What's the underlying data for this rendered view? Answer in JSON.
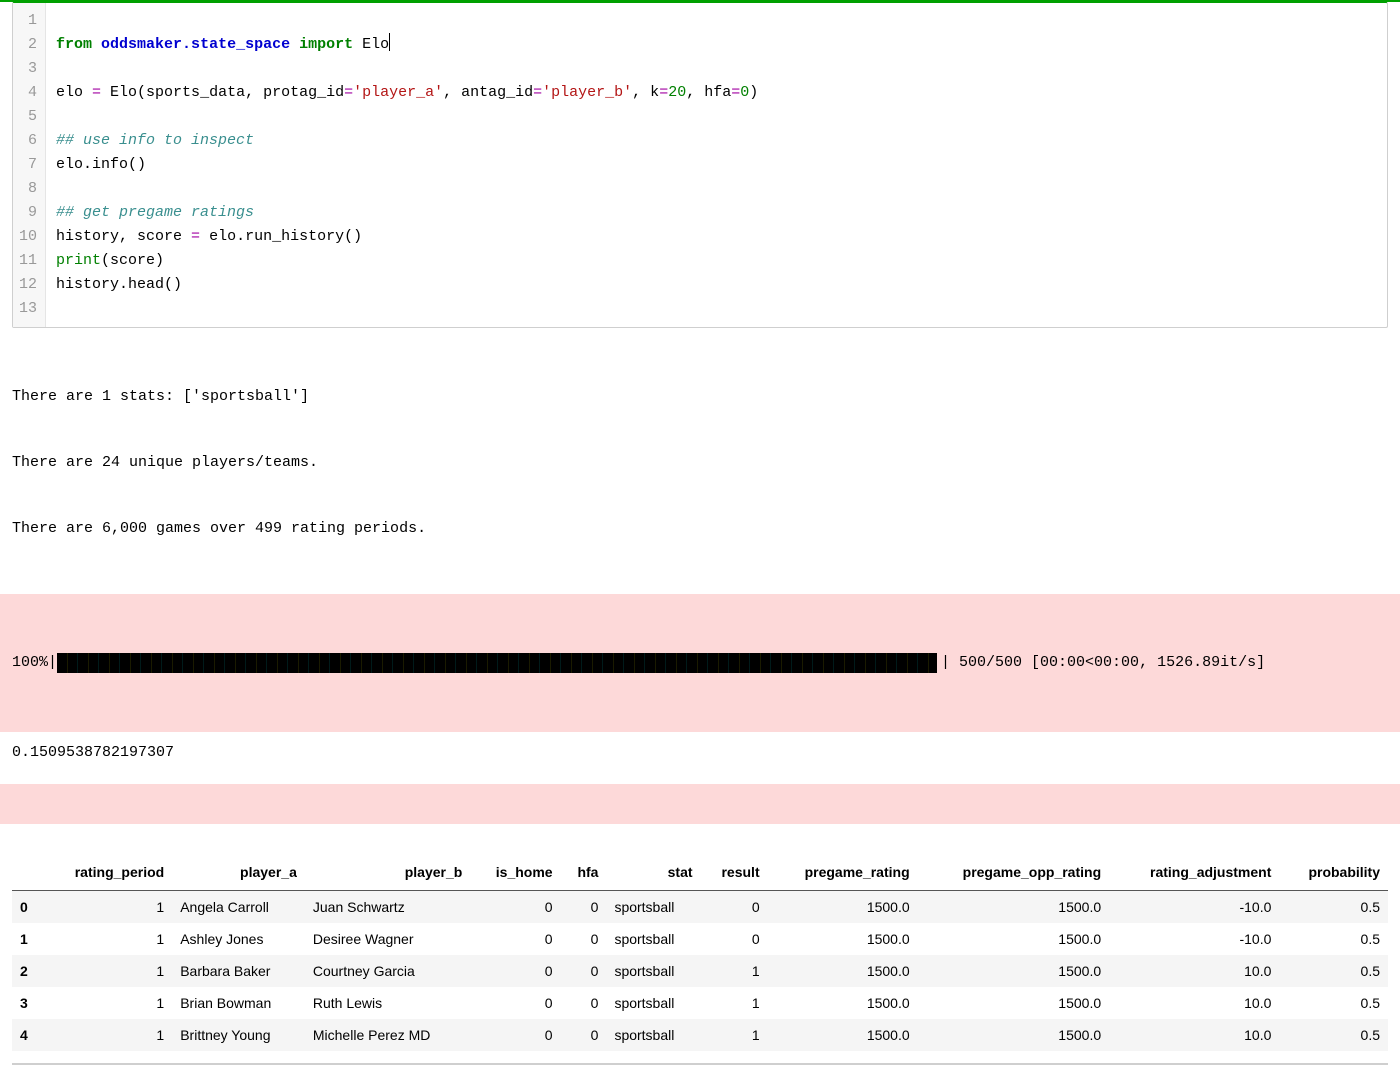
{
  "code": {
    "lines": [
      {
        "n": "1",
        "html": ""
      },
      {
        "n": "2",
        "html": "<span class='kw'>from</span> <span class='mod'>oddsmaker.state_space</span> <span class='kw'>import</span> Elo<span class='cursor'></span>"
      },
      {
        "n": "3",
        "html": ""
      },
      {
        "n": "4",
        "html": "elo <span class='op'>=</span> Elo(sports_data, protag_id<span class='op'>=</span><span class='str'>'player_a'</span>, antag_id<span class='op'>=</span><span class='str'>'player_b'</span>, k<span class='op'>=</span><span class='num'>20</span>, hfa<span class='op'>=</span><span class='num'>0</span>)"
      },
      {
        "n": "5",
        "html": ""
      },
      {
        "n": "6",
        "html": "<span class='comment'>## use info to inspect</span>"
      },
      {
        "n": "7",
        "html": "elo.info()"
      },
      {
        "n": "8",
        "html": ""
      },
      {
        "n": "9",
        "html": "<span class='comment'>## get pregame ratings</span>"
      },
      {
        "n": "10",
        "html": "history, score <span class='op'>=</span> elo.run_history()"
      },
      {
        "n": "11",
        "html": "<span class='builtin'>print</span>(score)"
      },
      {
        "n": "12",
        "html": "history.head()"
      },
      {
        "n": "13",
        "html": ""
      }
    ]
  },
  "output_info": {
    "line1": "There are 1 stats: ['sportsball']",
    "line2": "There are 24 unique players/teams.",
    "line3": "There are 6,000 games over 499 rating periods."
  },
  "progress": {
    "percent": "100%",
    "suffix": "| 500/500 [00:00<00:00, 1526.89it/s]"
  },
  "score": "0.1509538782197307",
  "table": {
    "columns": [
      "",
      "rating_period",
      "player_a",
      "player_b",
      "is_home",
      "hfa",
      "stat",
      "result",
      "pregame_rating",
      "pregame_opp_rating",
      "rating_adjustment",
      "probability"
    ],
    "rows": [
      {
        "idx": "0",
        "rating_period": "1",
        "player_a": "Angela Carroll",
        "player_b": "Juan Schwartz",
        "is_home": "0",
        "hfa": "0",
        "stat": "sportsball",
        "result": "0",
        "pregame_rating": "1500.0",
        "pregame_opp_rating": "1500.0",
        "rating_adjustment": "-10.0",
        "probability": "0.5"
      },
      {
        "idx": "1",
        "rating_period": "1",
        "player_a": "Ashley Jones",
        "player_b": "Desiree Wagner",
        "is_home": "0",
        "hfa": "0",
        "stat": "sportsball",
        "result": "0",
        "pregame_rating": "1500.0",
        "pregame_opp_rating": "1500.0",
        "rating_adjustment": "-10.0",
        "probability": "0.5"
      },
      {
        "idx": "2",
        "rating_period": "1",
        "player_a": "Barbara Baker",
        "player_b": "Courtney Garcia",
        "is_home": "0",
        "hfa": "0",
        "stat": "sportsball",
        "result": "1",
        "pregame_rating": "1500.0",
        "pregame_opp_rating": "1500.0",
        "rating_adjustment": "10.0",
        "probability": "0.5"
      },
      {
        "idx": "3",
        "rating_period": "1",
        "player_a": "Brian Bowman",
        "player_b": "Ruth Lewis",
        "is_home": "0",
        "hfa": "0",
        "stat": "sportsball",
        "result": "1",
        "pregame_rating": "1500.0",
        "pregame_opp_rating": "1500.0",
        "rating_adjustment": "10.0",
        "probability": "0.5"
      },
      {
        "idx": "4",
        "rating_period": "1",
        "player_a": "Brittney Young",
        "player_b": "Michelle Perez MD",
        "is_home": "0",
        "hfa": "0",
        "stat": "sportsball",
        "result": "1",
        "pregame_rating": "1500.0",
        "pregame_opp_rating": "1500.0",
        "rating_adjustment": "10.0",
        "probability": "0.5"
      }
    ]
  }
}
